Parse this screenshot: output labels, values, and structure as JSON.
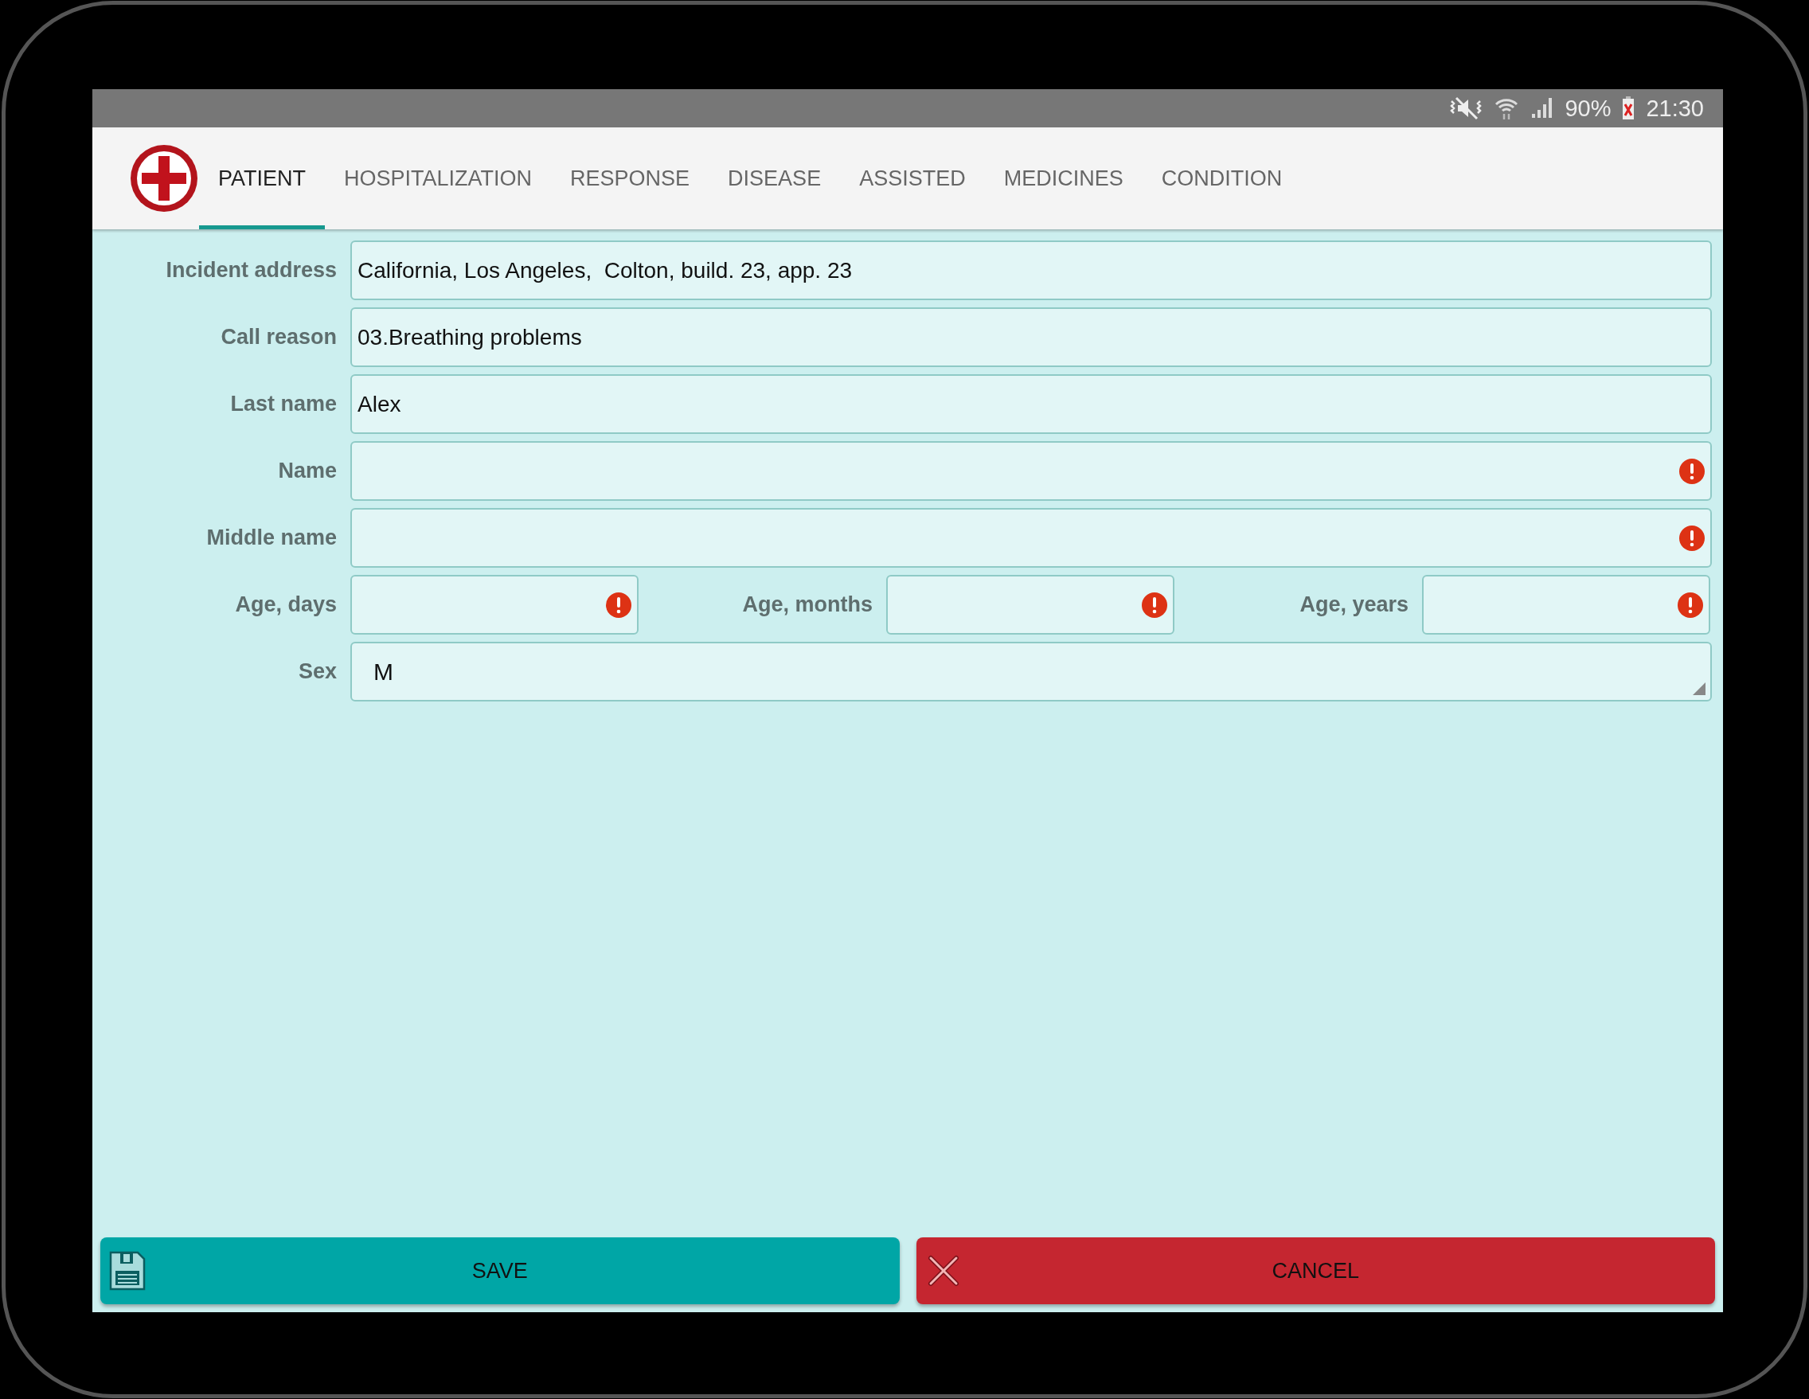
{
  "status_bar": {
    "battery": "90%",
    "time": "21:30"
  },
  "tabs": [
    {
      "label": "PATIENT",
      "selected": true
    },
    {
      "label": "HOSPITALIZATION",
      "selected": false
    },
    {
      "label": "RESPONSE",
      "selected": false
    },
    {
      "label": "DISEASE",
      "selected": false
    },
    {
      "label": "ASSISTED",
      "selected": false
    },
    {
      "label": "MEDICINES",
      "selected": false
    },
    {
      "label": "CONDITION",
      "selected": false
    }
  ],
  "form": {
    "rows": [
      {
        "fields": [
          {
            "label": "Incident address",
            "value": "California, Los Angeles,  Colton, build. 23, app. 23",
            "kind": "text",
            "error": false
          }
        ]
      },
      {
        "fields": [
          {
            "label": "Call reason",
            "value": "03.Breathing problems",
            "kind": "text",
            "error": false
          }
        ]
      },
      {
        "fields": [
          {
            "label": "Last name",
            "value": "Alex",
            "kind": "text",
            "error": false
          }
        ]
      },
      {
        "fields": [
          {
            "label": "Name",
            "kind": "text",
            "error": true
          }
        ]
      },
      {
        "fields": [
          {
            "label": "Middle name",
            "kind": "text",
            "error": true
          }
        ]
      },
      {
        "fields": [
          {
            "label": "Age, days",
            "kind": "text",
            "error": true
          },
          {
            "label": "Age, months",
            "kind": "text",
            "error": true
          },
          {
            "label": "Age, years",
            "kind": "text",
            "error": true
          }
        ]
      },
      {
        "fields": [
          {
            "label": "Sex",
            "value": "M",
            "kind": "select",
            "error": false
          }
        ]
      }
    ]
  },
  "buttons": [
    {
      "label": "SAVE",
      "kind": "save"
    },
    {
      "label": "CANCEL",
      "kind": "cancel"
    }
  ]
}
